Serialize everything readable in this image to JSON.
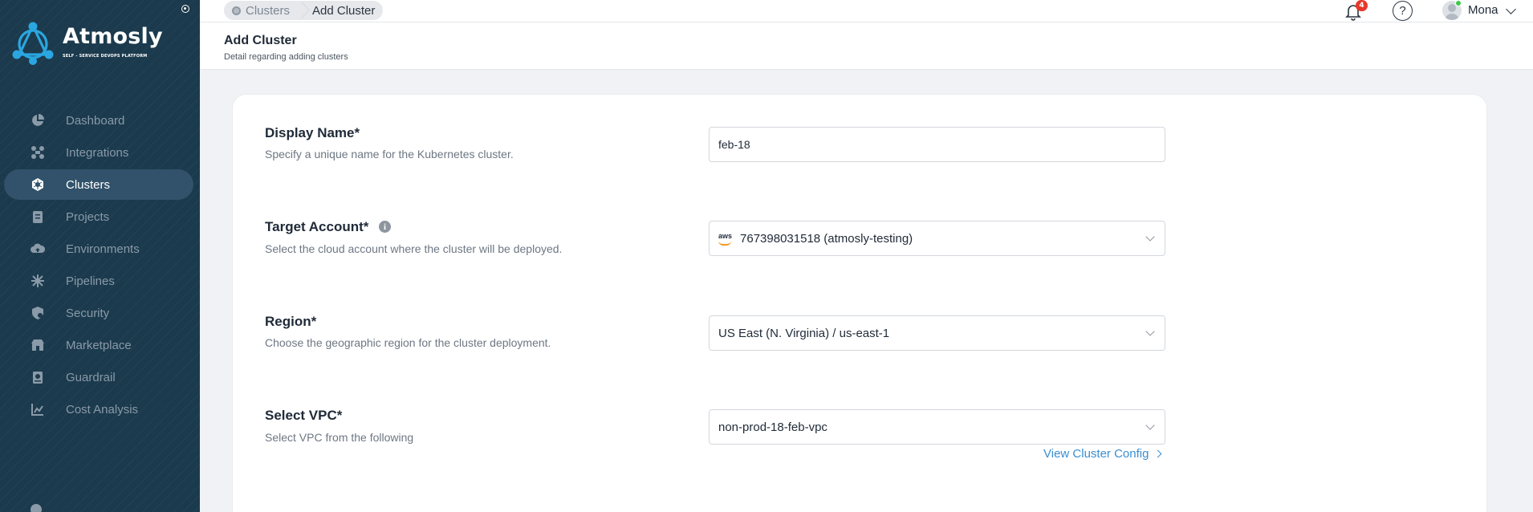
{
  "brand": {
    "name": "Atmosly",
    "tagline": "SELF - SERVICE DEVOPS PLATFORM"
  },
  "sidebar": {
    "items": [
      {
        "label": "Dashboard",
        "icon": "pie-chart-icon",
        "active": false
      },
      {
        "label": "Integrations",
        "icon": "integrations-icon",
        "active": false
      },
      {
        "label": "Clusters",
        "icon": "kubernetes-icon",
        "active": true
      },
      {
        "label": "Projects",
        "icon": "projects-icon",
        "active": false
      },
      {
        "label": "Environments",
        "icon": "cloud-icon",
        "active": false
      },
      {
        "label": "Pipelines",
        "icon": "pipelines-icon",
        "active": false
      },
      {
        "label": "Security",
        "icon": "shield-icon",
        "active": false
      },
      {
        "label": "Marketplace",
        "icon": "marketplace-icon",
        "active": false
      },
      {
        "label": "Guardrail",
        "icon": "guardrail-icon",
        "active": false
      },
      {
        "label": "Cost Analysis",
        "icon": "cost-icon",
        "active": false
      }
    ]
  },
  "breadcrumb": {
    "items": [
      "Clusters",
      "Add Cluster"
    ]
  },
  "header": {
    "notification_count": "4",
    "help_glyph": "?",
    "user_name": "Mona"
  },
  "page": {
    "title": "Add Cluster",
    "subtitle": "Detail regarding adding clusters"
  },
  "form": {
    "display_name": {
      "label": "Display Name*",
      "description": "Specify a unique name for the Kubernetes cluster.",
      "value": "feb-18"
    },
    "target_account": {
      "label": "Target Account*",
      "description": "Select the cloud account where the cluster will be deployed.",
      "provider": "aws",
      "value": "767398031518 (atmosly-testing)"
    },
    "region": {
      "label": "Region*",
      "description": "Choose the geographic region for the cluster deployment.",
      "value": "US East (N. Virginia) / us-east-1"
    },
    "vpc": {
      "label": "Select VPC*",
      "description": "Select VPC from the following",
      "value": "non-prod-18-feb-vpc"
    },
    "config_link": "View Cluster Config"
  },
  "colors": {
    "sidebar_bg": "#1b3a4d",
    "sidebar_active": "#31526a",
    "link": "#3a8ed0",
    "badge": "#e5382b",
    "online": "#3cc94a"
  }
}
